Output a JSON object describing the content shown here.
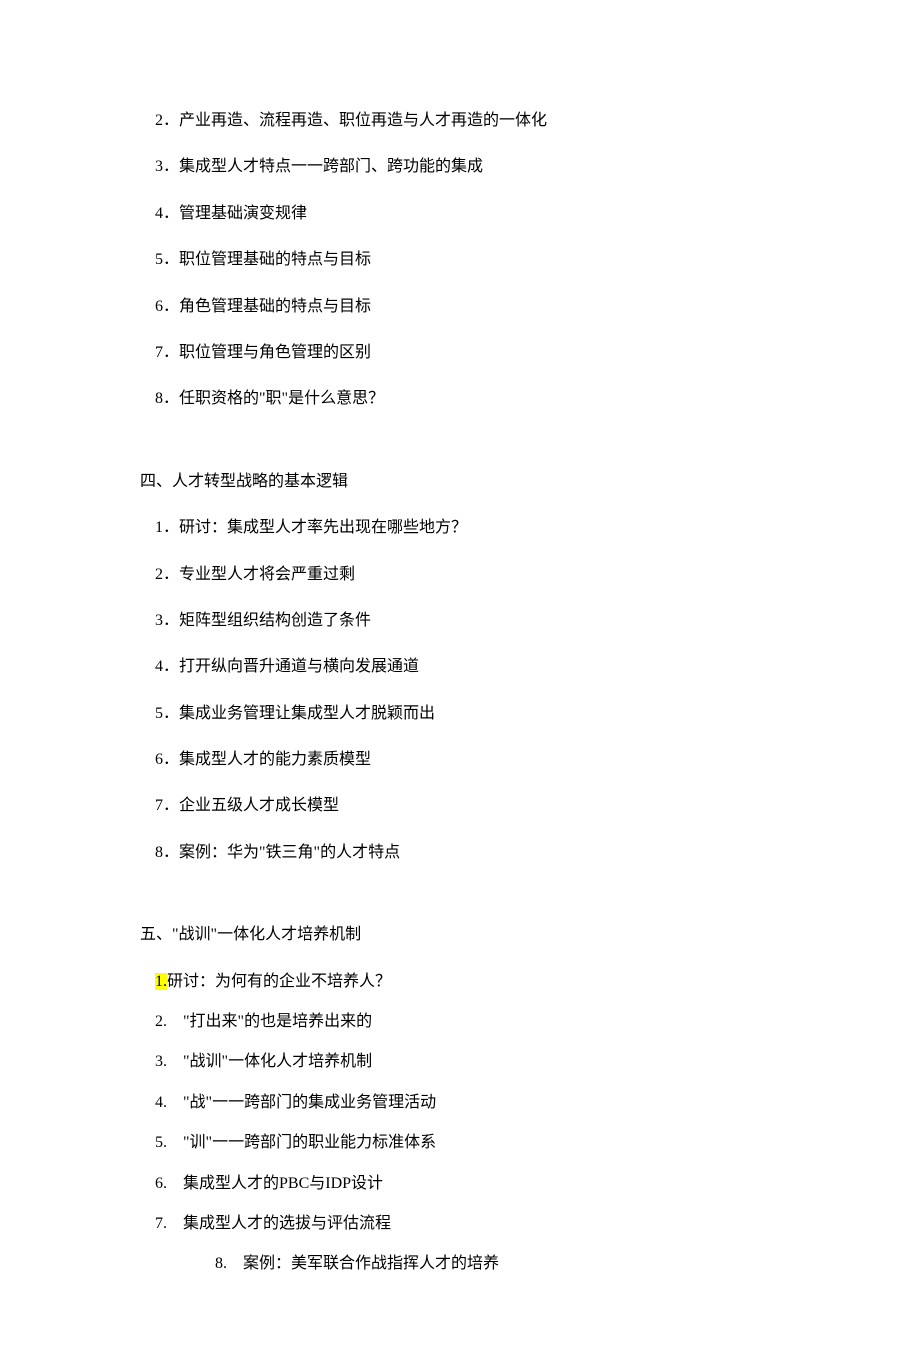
{
  "section3": {
    "items": [
      {
        "num": "2",
        "text": "．产业再造、流程再造、职位再造与人才再造的一体化"
      },
      {
        "num": "3",
        "text": "．集成型人才特点一一跨部门、跨功能的集成"
      },
      {
        "num": "4",
        "text": "．管理基础演变规律"
      },
      {
        "num": "5",
        "text": "．职位管理基础的特点与目标"
      },
      {
        "num": "6",
        "text": "．角色管理基础的特点与目标"
      },
      {
        "num": "7",
        "text": "．职位管理与角色管理的区别"
      },
      {
        "num": "8",
        "text": "．任职资格的\"职\"是什么意思？"
      }
    ]
  },
  "section4": {
    "heading": "四、人才转型战略的基本逻辑",
    "items": [
      {
        "num": "1",
        "text": "．研讨：集成型人才率先出现在哪些地方？"
      },
      {
        "num": "2",
        "text": "．专业型人才将会严重过剩"
      },
      {
        "num": "3",
        "text": "．矩阵型组织结构创造了条件"
      },
      {
        "num": "4",
        "text": "．打开纵向晋升通道与横向发展通道"
      },
      {
        "num": "5",
        "text": "．集成业务管理让集成型人才脱颖而出"
      },
      {
        "num": "6",
        "text": "．集成型人才的能力素质模型"
      },
      {
        "num": "7",
        "text": "．企业五级人才成长模型"
      },
      {
        "num": "8",
        "text": "．案例：华为\"铁三角\"的人才特点"
      }
    ]
  },
  "section5": {
    "heading": "五、\"战训\"一体化人才培养机制",
    "items": [
      {
        "num": "1.",
        "text": "研讨：为何有的企业不培养人？",
        "highlight": true
      },
      {
        "num": "2.",
        "text": "　\"打出来\"的也是培养出来的"
      },
      {
        "num": "3.",
        "text": "　\"战训\"一体化人才培养机制"
      },
      {
        "num": "4.",
        "text": "　\"战\"一一跨部门的集成业务管理活动"
      },
      {
        "num": "5.",
        "text": "　\"训\"一一跨部门的职业能力标准体系"
      },
      {
        "num": "6.",
        "text": "　集成型人才的PBC与IDP设计"
      },
      {
        "num": "7.",
        "text": "　集成型人才的选拔与评估流程"
      },
      {
        "num": "8.",
        "text": "　案例：美军联合作战指挥人才的培养",
        "extra_indent": true
      }
    ]
  }
}
